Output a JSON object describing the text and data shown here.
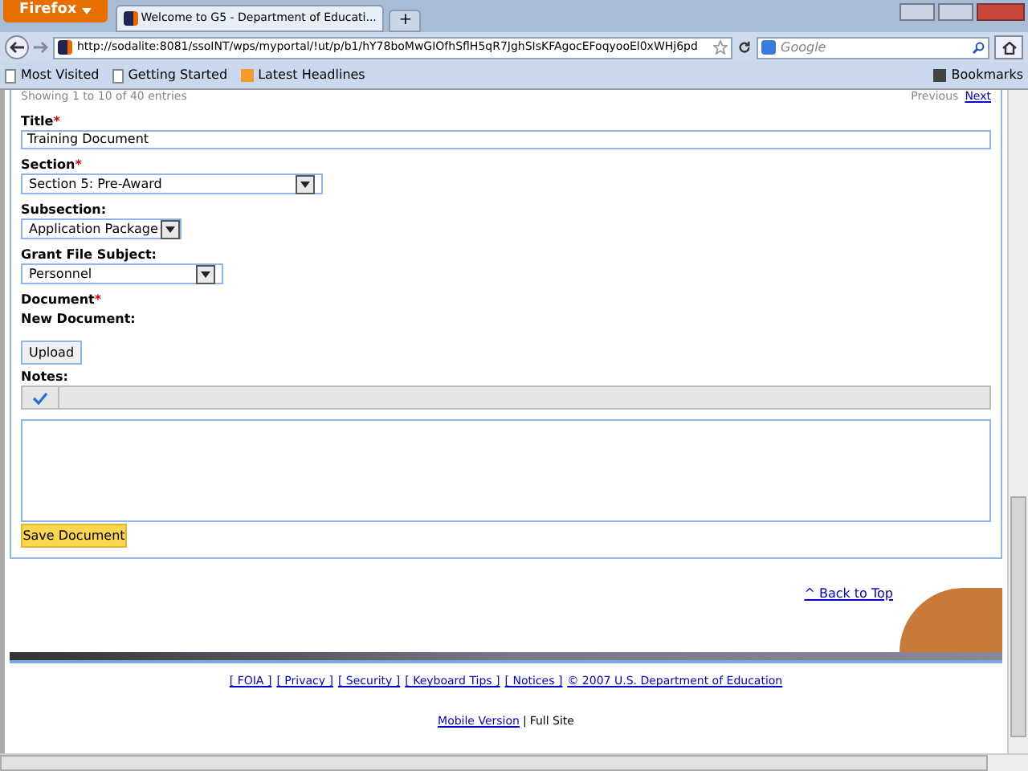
{
  "browser": {
    "menu_button": "Firefox",
    "tab_title": "Welcome to G5 - Department of Educati...",
    "new_tab": "+",
    "url": "http://sodalite:8081/ssoINT/wps/myportal/!ut/p/b1/hY78boMwGIOfhSflH5qR7JghSIsKFAgocEFoqyooEl0xWHj6pd",
    "search_placeholder": "Google",
    "bookmarks": [
      "Most Visited",
      "Getting Started",
      "Latest Headlines"
    ],
    "bookmarks_menu": "Bookmarks"
  },
  "paging": {
    "summary": "Showing 1 to 10 of 40 entries",
    "previous": "Previous",
    "next": "Next"
  },
  "form": {
    "title_label": "Title",
    "title_value": "Training Document",
    "section_label": "Section",
    "section_value": "Section 5: Pre-Award",
    "subsection_label": "Subsection:",
    "subsection_value": "Application Package",
    "subject_label": "Grant File Subject:",
    "subject_value": "Personnel",
    "document_label": "Document",
    "new_document_label": "New Document:",
    "upload": "Upload",
    "notes_label": "Notes:",
    "required_mark": "*",
    "save": "Save Document"
  },
  "footer": {
    "back_to_top": "^ Back to Top",
    "links": [
      "[ FOIA ]",
      "[ Privacy ]",
      "[ Security ]",
      "[ Keyboard Tips ]",
      "[ Notices ]",
      "© 2007 U.S. Department of Education"
    ],
    "mobile": "Mobile Version",
    "separator": "|",
    "full_site": "Full Site"
  }
}
